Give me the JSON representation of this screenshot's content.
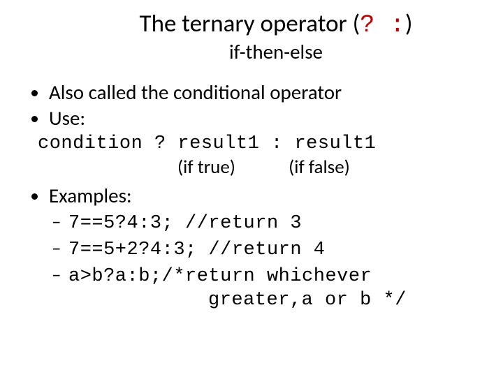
{
  "title": {
    "prefix": "The ternary operator (",
    "op1": "?",
    "gap": "  ",
    "op2": ":",
    "suffix": ")",
    "subtitle": "if-then-else"
  },
  "bullets": {
    "b1": "Also called the conditional operator",
    "b2": "Use:",
    "use_code": "condition ? result1 : result1",
    "if_true": "(if true)",
    "if_false": "(if false)",
    "b3": "Examples:"
  },
  "examples": {
    "e1": "7==5?4:3; //return 3",
    "e2": "7==5+2?4:3; //return 4",
    "e3a": "a>b?a:b;/*return whichever",
    "e3b": "greater,a or b */"
  }
}
